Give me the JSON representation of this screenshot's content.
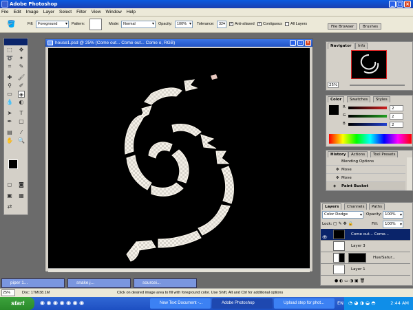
{
  "app": {
    "title": "Adobe Photoshop"
  },
  "menu": [
    "File",
    "Edit",
    "Image",
    "Layer",
    "Select",
    "Filter",
    "View",
    "Window",
    "Help"
  ],
  "options": {
    "fill_label": "Fill:",
    "fill_value": "Foreground",
    "pattern_label": "Pattern:",
    "mode_label": "Mode:",
    "mode_value": "Normal",
    "opacity_label": "Opacity:",
    "opacity_value": "100%",
    "tolerance_label": "Tolerance:",
    "tolerance_value": "32",
    "antialiased": "Anti-aliased",
    "contiguous": "Contiguous",
    "all_layers": "All Layers"
  },
  "palette_well": {
    "file_browser": "File Browser",
    "brushes": "Brushes"
  },
  "document": {
    "title": "house1.psd @ 25% (Come out... Come out... Come o, RGB)"
  },
  "navigator": {
    "tabs": [
      "Navigator",
      "Info"
    ],
    "zoom": "25%"
  },
  "color": {
    "tabs": [
      "Color",
      "Swatches",
      "Styles"
    ],
    "channels": [
      {
        "label": "R",
        "value": "2",
        "color": "#d02020"
      },
      {
        "label": "G",
        "value": "2",
        "color": "#20a020"
      },
      {
        "label": "B",
        "value": "2",
        "color": "#2040d0"
      }
    ]
  },
  "history": {
    "tabs": [
      "History",
      "Actions",
      "Tool Presets"
    ],
    "items": [
      "Blending Options",
      "Move",
      "Move",
      "Paint Bucket"
    ]
  },
  "layers": {
    "tabs": [
      "Layers",
      "Channels",
      "Paths"
    ],
    "blend_mode": "Color Dodge",
    "opacity_label": "Opacity:",
    "opacity_value": "100%",
    "lock_label": "Lock:",
    "fill_label": "Fill:",
    "fill_value": "100%",
    "rows": [
      "Come out... Come...",
      "Layer 3",
      "Hue/Satur...",
      "Layer 1"
    ]
  },
  "minimized_docs": [
    "piper 1...",
    "snake.j...",
    "sourcei..."
  ],
  "status": {
    "zoom": "25%",
    "doc": "Doc: 17M/38.1M",
    "hint": "Click on desired image area to fill with foreground color. Use Shift, Alt and Ctrl for additional options"
  },
  "taskbar": {
    "start": "start",
    "items": [
      "New Text Document -...",
      "Adobe Photoshop",
      "Upload step for phot..."
    ],
    "lang": "EN",
    "time": "2:44 AM"
  }
}
